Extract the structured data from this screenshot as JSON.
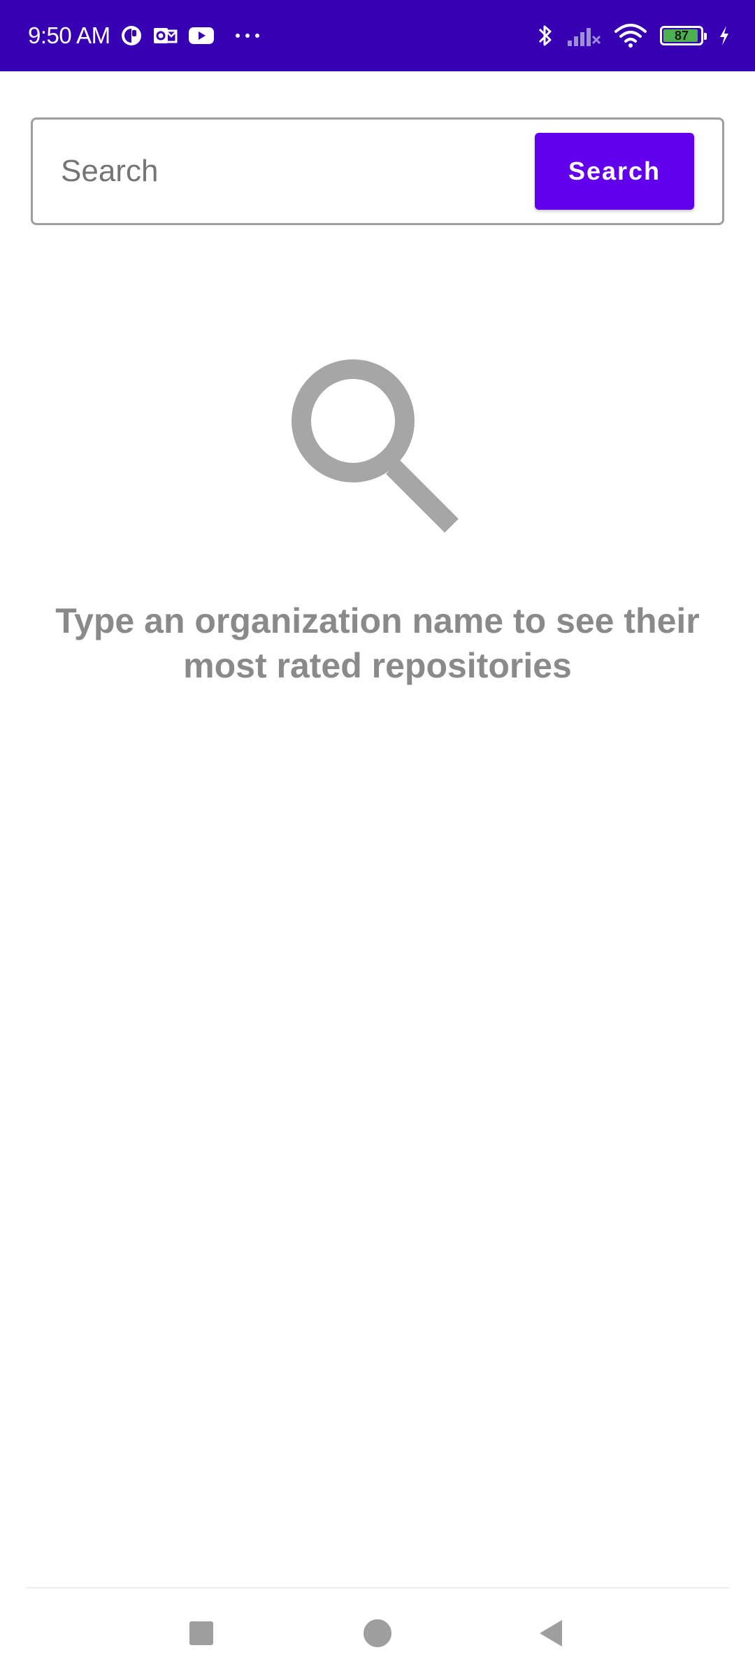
{
  "status_bar": {
    "time": "9:50 AM",
    "battery_level": "87",
    "left_icons": [
      "circle-half-icon",
      "outlook-icon",
      "youtube-icon",
      "more-dots-icon"
    ],
    "right_icons": [
      "bluetooth-icon",
      "cellular-signal-off-icon",
      "wifi-icon",
      "battery-icon",
      "charging-icon"
    ],
    "background_color": "#3700b3"
  },
  "search": {
    "placeholder": "Search",
    "value": "",
    "button_label": "Search",
    "button_color": "#6200ee"
  },
  "empty_state": {
    "icon": "search-icon",
    "message": "Type an organization name to see their most rated repositories"
  },
  "navigation_bar": {
    "buttons": [
      "recents-button",
      "home-button",
      "back-button"
    ]
  }
}
